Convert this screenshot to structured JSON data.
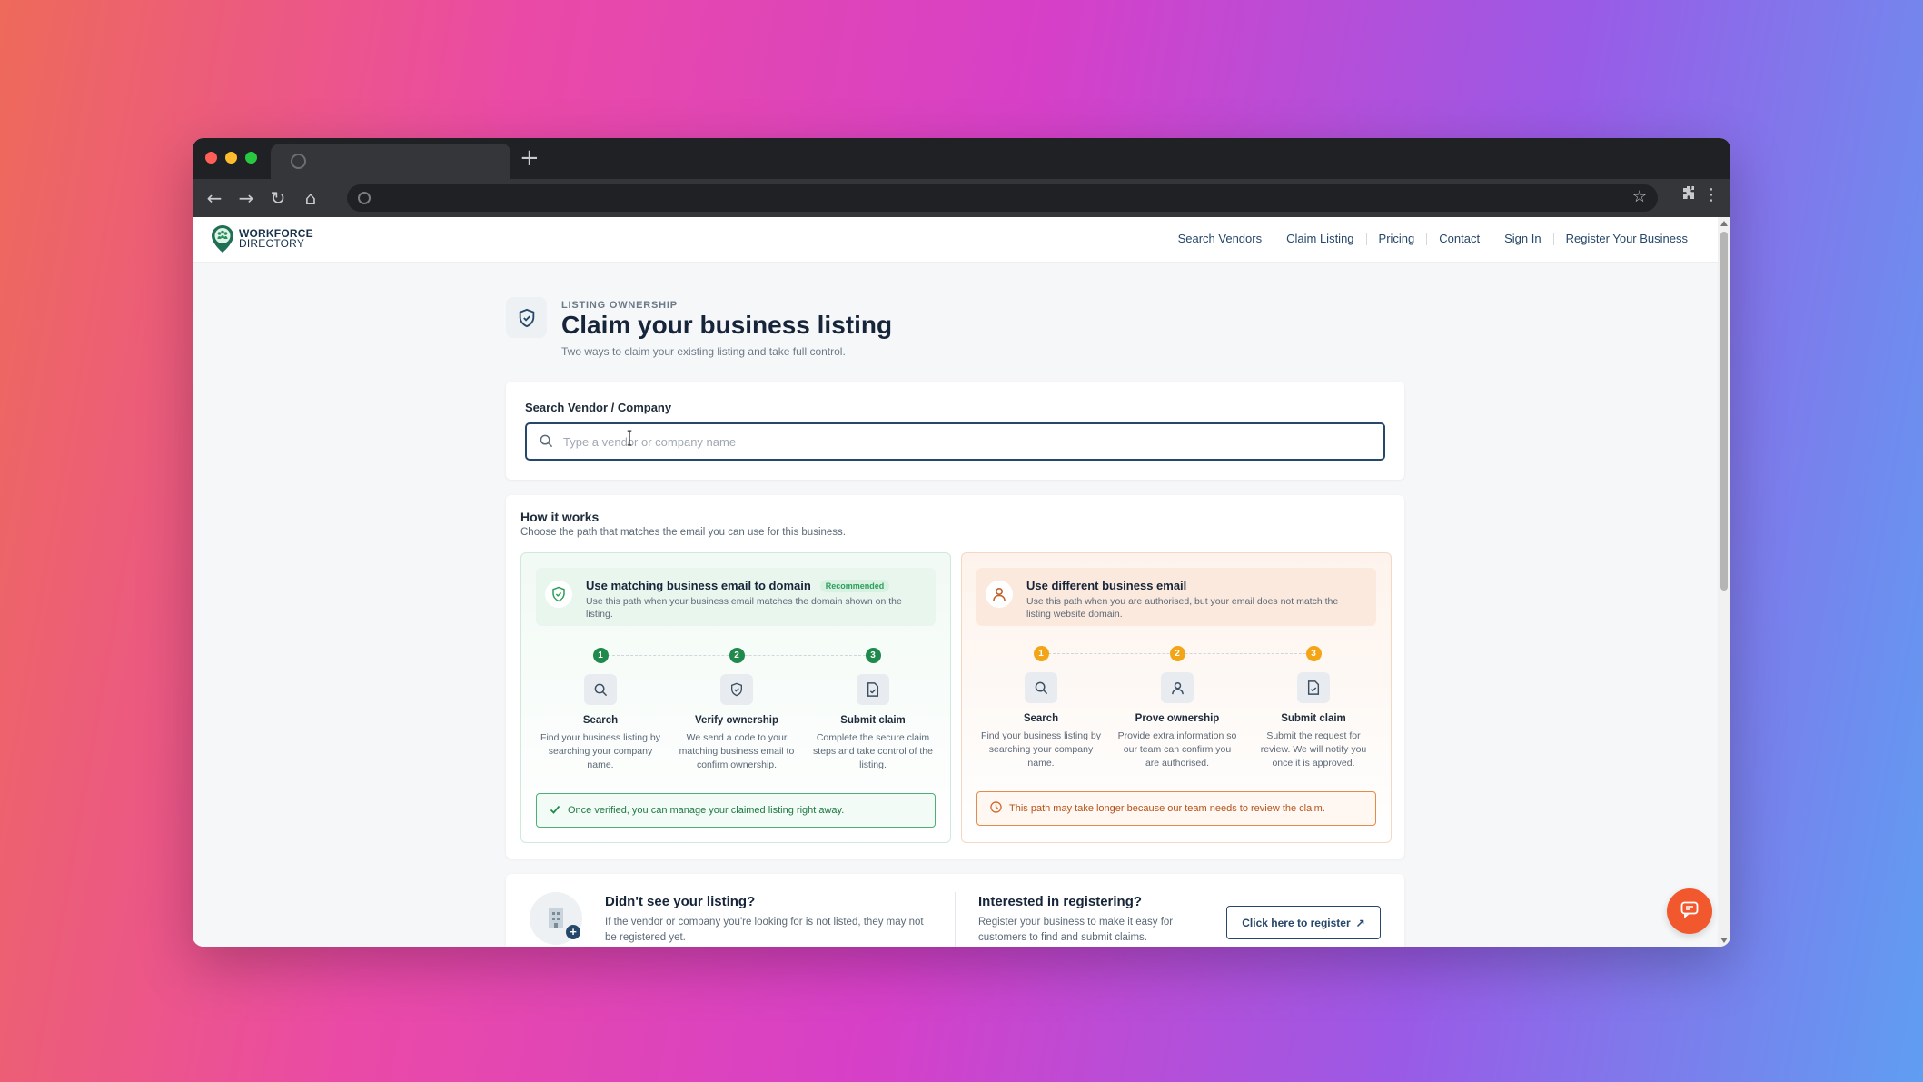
{
  "browser": {
    "new_tab_symbol": "+",
    "nav_back": "←",
    "nav_forward": "→",
    "nav_reload": "↻",
    "nav_home": "⌂",
    "bookmark_icon": "☆",
    "extensions_icon": "puzzle-icon",
    "menu_icon": "⋮"
  },
  "site": {
    "logo_line1": "WORKFORCE",
    "logo_line2": "DIRECTORY",
    "brand_colors": {
      "navy": "#25476a",
      "green": "#1f8a4c",
      "orange": "#f2a516",
      "accent": "#f1582d"
    },
    "nav": [
      {
        "label": "Search Vendors"
      },
      {
        "label": "Claim Listing"
      },
      {
        "label": "Pricing"
      },
      {
        "label": "Contact"
      },
      {
        "label": "Sign In"
      },
      {
        "label": "Register Your Business"
      }
    ]
  },
  "header": {
    "eyebrow": "LISTING OWNERSHIP",
    "title": "Claim your business listing",
    "subtitle": "Two ways to claim your existing listing and take full control."
  },
  "search": {
    "label": "Search Vendor / Company",
    "placeholder": "Type a vendor or company name",
    "value": ""
  },
  "how": {
    "title": "How it works",
    "subtitle": "Choose the path that matches the email you can use for this business.",
    "paths": [
      {
        "title": "Use matching business email to domain",
        "badge": "Recommended",
        "description": "Use this path when your business email matches the domain shown on the listing.",
        "steps": [
          {
            "num": "1",
            "title": "Search",
            "desc": "Find your business listing by searching your company name.",
            "icon": "search-icon"
          },
          {
            "num": "2",
            "title": "Verify ownership",
            "desc": "We send a code to your matching business email to confirm ownership.",
            "icon": "shield-icon"
          },
          {
            "num": "3",
            "title": "Submit claim",
            "desc": "Complete the secure claim steps and take control of the listing.",
            "icon": "document-icon"
          }
        ],
        "note": "Once verified, you can manage your claimed listing right away."
      },
      {
        "title": "Use different business email",
        "description": "Use this path when you are authorised, but your email does not match the listing website domain.",
        "steps": [
          {
            "num": "1",
            "title": "Search",
            "desc": "Find your business listing by searching your company name.",
            "icon": "search-icon"
          },
          {
            "num": "2",
            "title": "Prove ownership",
            "desc": "Provide extra information so our team can confirm you are authorised.",
            "icon": "user-icon"
          },
          {
            "num": "3",
            "title": "Submit claim",
            "desc": "Submit the request for review. We will notify you once it is approved.",
            "icon": "document-icon"
          }
        ],
        "note": "This path may take longer because our team needs to review the claim."
      }
    ]
  },
  "bottom": {
    "missing_title": "Didn't see your listing?",
    "missing_desc": "If the vendor or company you're looking for is not listed, they may not be registered yet.",
    "register_title": "Interested in registering?",
    "register_desc": "Register your business to make it easy for customers to find and submit claims.",
    "register_button": "Click here to register",
    "register_button_icon": "↗"
  },
  "chat": {
    "icon": "chat-icon"
  }
}
